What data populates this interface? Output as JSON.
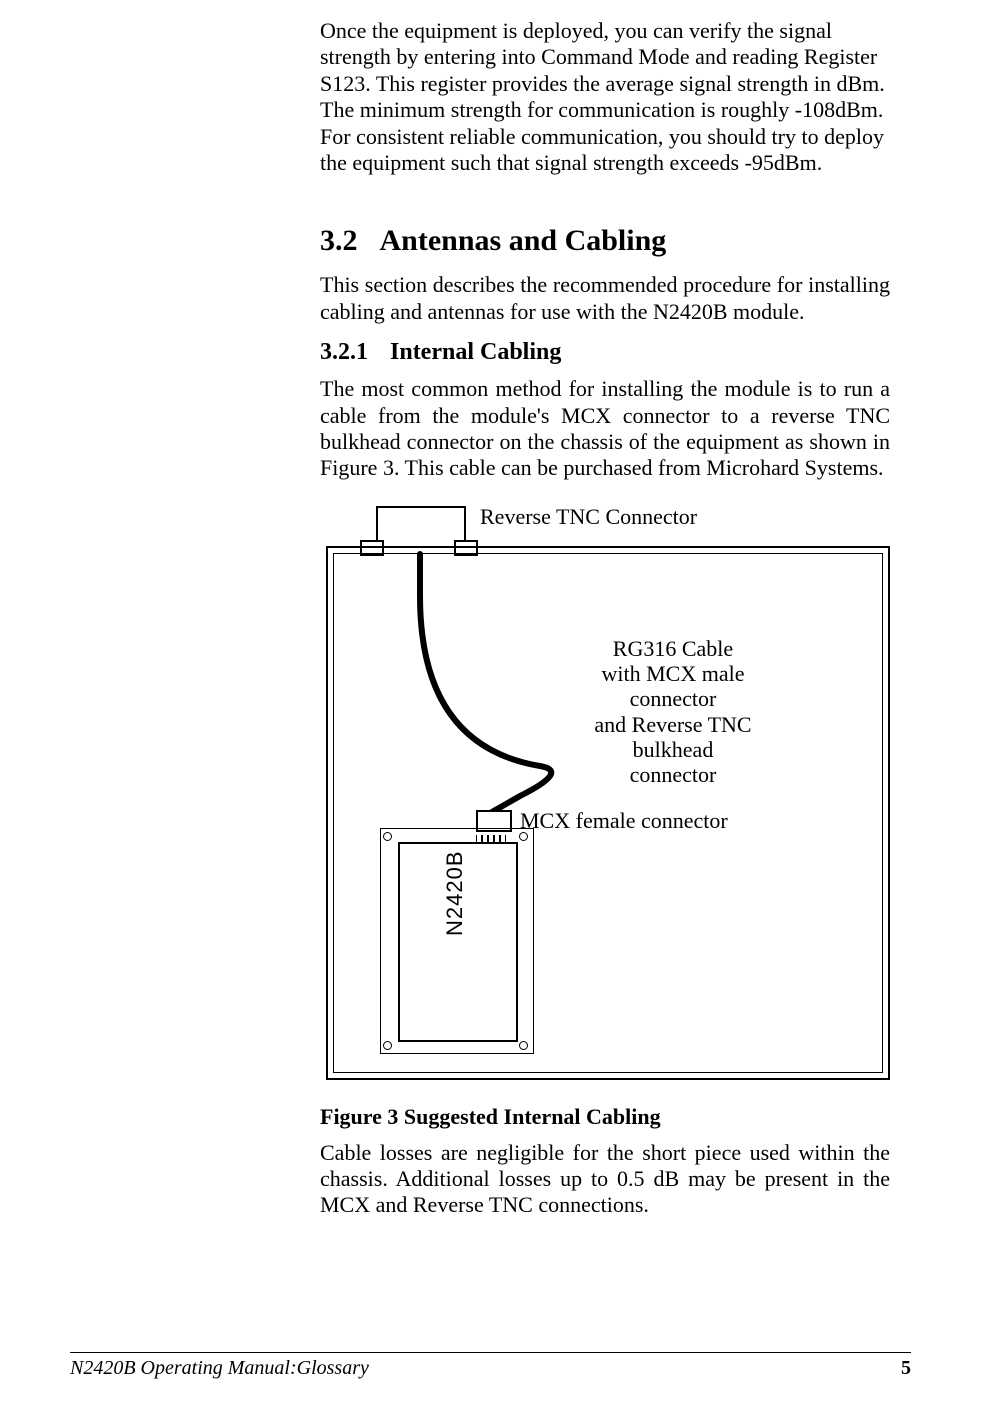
{
  "body": {
    "intro_para": "Once the equipment is deployed, you can verify the signal strength by entering into Command Mode and reading Register S123.  This register provides the average signal strength in dBm.  The minimum strength for communication is roughly -108dBm.  For consistent reliable communication, you should try to deploy the equipment such that signal strength exceeds -95dBm.",
    "sec32_num": "3.2",
    "sec32_title": "Antennas and Cabling",
    "sec32_para": "This section describes the recommended procedure for installing cabling and antennas for use with the N2420B module.",
    "sec321_num": "3.2.1",
    "sec321_title": "Internal Cabling",
    "sec321_para": "The most common method for installing the module is to run a cable from the module's MCX connector to a reverse TNC bulkhead connector on the chassis of the equipment as shown in Figure 3.  This cable can be purchased from Microhard Systems.",
    "fig_caption": "Figure 3 Suggested Internal Cabling",
    "post_fig_para": "Cable losses are negligible for the short piece used within the chassis.  Additional losses up to 0.5 dB may be present in the MCX and Reverse TNC connections."
  },
  "figure": {
    "label_tnc": "Reverse TNC Connector",
    "label_cable": "RG316 Cable\nwith MCX male\nconnector\nand Reverse TNC\nbulkhead\nconnector",
    "label_mcx": "MCX female connector",
    "module_label": "N2420B"
  },
  "footer": {
    "left": "N2420B Operating Manual:Glossary",
    "page": "5"
  }
}
